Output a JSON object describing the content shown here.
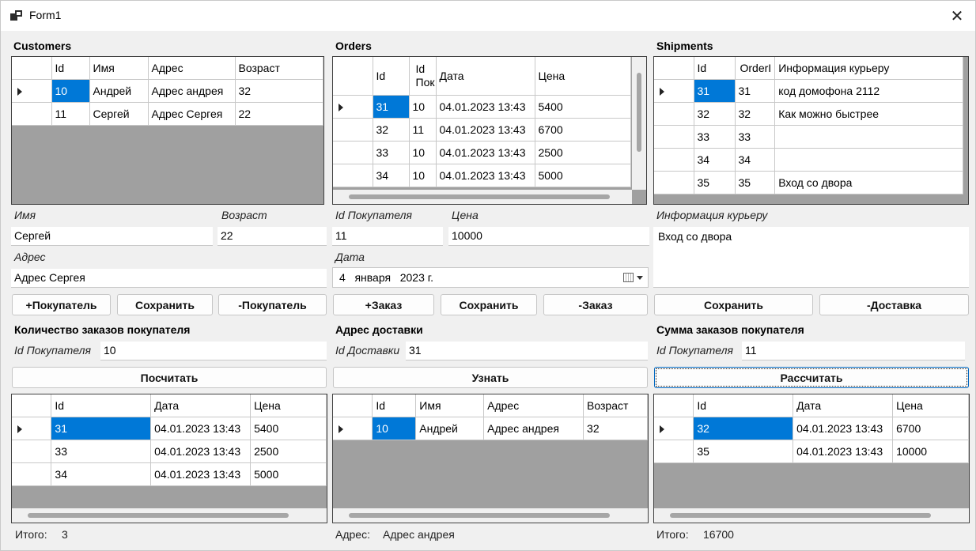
{
  "window": {
    "title": "Form1",
    "close": "✕"
  },
  "customers": {
    "title": "Customers",
    "columns": [
      "Id",
      "Имя",
      "Адрес",
      "Возраст"
    ],
    "rows": [
      [
        "10",
        "Андрей",
        "Адрес андрея",
        "32"
      ],
      [
        "11",
        "Сергей",
        "Адрес Сергея",
        "22"
      ]
    ],
    "name_label": "Имя",
    "name_value": "Сергей",
    "age_label": "Возраст",
    "age_value": "22",
    "address_label": "Адрес",
    "address_value": "Адрес Сергея",
    "add_button": "+Покупатель",
    "save_button": "Сохранить",
    "remove_button": "-Покупатель"
  },
  "orders": {
    "title": "Orders",
    "columns": [
      "Id",
      "Id Пок",
      "Дата",
      "Цена"
    ],
    "rows": [
      [
        "31",
        "10",
        "04.01.2023 13:43",
        "5400"
      ],
      [
        "32",
        "11",
        "04.01.2023 13:43",
        "6700"
      ],
      [
        "33",
        "10",
        "04.01.2023 13:43",
        "2500"
      ],
      [
        "34",
        "10",
        "04.01.2023 13:43",
        "5000"
      ]
    ],
    "customer_id_label": "Id Покупателя",
    "customer_id_value": "11",
    "price_label": "Цена",
    "price_value": "10000",
    "date_label": "Дата",
    "date_value": "4   января   2023 г.",
    "add_button": "+Заказ",
    "save_button": "Сохранить",
    "remove_button": "-Заказ"
  },
  "shipments": {
    "title": "Shipments",
    "columns": [
      "Id",
      "OrderI",
      "Информация курьеру"
    ],
    "rows": [
      [
        "31",
        "31",
        "код домофона 2112"
      ],
      [
        "32",
        "32",
        "Как можно быстрее"
      ],
      [
        "33",
        "33",
        ""
      ],
      [
        "34",
        "34",
        ""
      ],
      [
        "35",
        "35",
        "Вход со двора"
      ]
    ],
    "courier_info_label": "Информация курьеру",
    "courier_info_value": "Вход со двора",
    "save_button": "Сохранить",
    "remove_button": "-Доставка"
  },
  "order_count": {
    "title": "Количество заказов покупателя",
    "customer_id_label": "Id Покупателя",
    "customer_id_value": "10",
    "button": "Посчитать",
    "columns": [
      "Id",
      "Дата",
      "Цена"
    ],
    "rows": [
      [
        "31",
        "04.01.2023 13:43",
        "5400"
      ],
      [
        "33",
        "04.01.2023 13:43",
        "2500"
      ],
      [
        "34",
        "04.01.2023 13:43",
        "5000"
      ]
    ],
    "total_label": "Итого:",
    "total_value": "3"
  },
  "delivery_address": {
    "title": "Адрес доставки",
    "delivery_id_label": "Id Доставки",
    "delivery_id_value": "31",
    "button": "Узнать",
    "columns": [
      "Id",
      "Имя",
      "Адрес",
      "Возраст"
    ],
    "rows": [
      [
        "10",
        "Андрей",
        "Адрес андрея",
        "32"
      ]
    ],
    "result_label": "Адрес:",
    "result_value": "Адрес андрея"
  },
  "order_sum": {
    "title": "Сумма заказов покупателя",
    "customer_id_label": "Id Покупателя",
    "customer_id_value": "11",
    "button": "Рассчитать",
    "columns": [
      "Id",
      "Дата",
      "Цена"
    ],
    "rows": [
      [
        "32",
        "04.01.2023 13:43",
        "6700"
      ],
      [
        "35",
        "04.01.2023 13:43",
        "10000"
      ]
    ],
    "total_label": "Итого:",
    "total_value": "16700"
  },
  "colors": {
    "selection": "#0078d7",
    "grid_background": "#a0a0a0",
    "form_background": "#f0f0f0"
  }
}
